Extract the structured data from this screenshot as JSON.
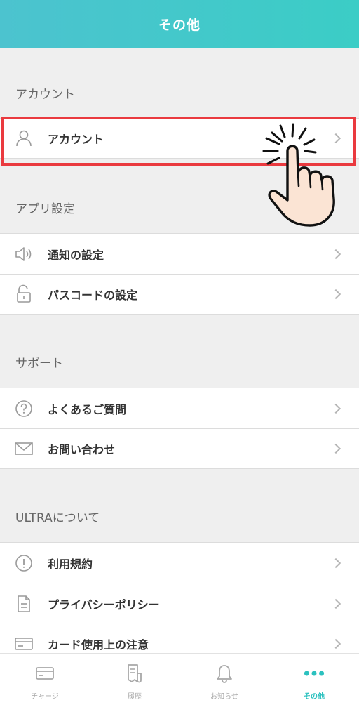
{
  "header": {
    "title": "その他"
  },
  "sections": {
    "account": {
      "title": "アカウント",
      "items": [
        {
          "label": "アカウント",
          "icon": "person-icon"
        }
      ]
    },
    "app_settings": {
      "title": "アプリ設定",
      "items": [
        {
          "label": "通知の設定",
          "icon": "speaker-icon"
        },
        {
          "label": "パスコードの設定",
          "icon": "unlock-icon"
        }
      ]
    },
    "support": {
      "title": "サポート",
      "items": [
        {
          "label": "よくあるご質問",
          "icon": "question-icon"
        },
        {
          "label": "お問い合わせ",
          "icon": "mail-icon"
        }
      ]
    },
    "about": {
      "title": "ULTRAについて",
      "items": [
        {
          "label": "利用規約",
          "icon": "exclamation-icon"
        },
        {
          "label": "プライバシーポリシー",
          "icon": "document-icon"
        },
        {
          "label": "カード使用上の注意",
          "icon": "card-icon"
        }
      ]
    }
  },
  "tabbar": {
    "items": [
      {
        "label": "チャージ",
        "icon": "card-icon"
      },
      {
        "label": "履歴",
        "icon": "receipt-icon"
      },
      {
        "label": "お知らせ",
        "icon": "bell-icon"
      },
      {
        "label": "その他",
        "icon": "more-dots-icon",
        "active": true
      }
    ]
  },
  "colors": {
    "accent": "#2cc1bf",
    "highlight": "#ea3a3f",
    "header_start": "#4cc3cf",
    "header_end": "#3bcdc6"
  }
}
